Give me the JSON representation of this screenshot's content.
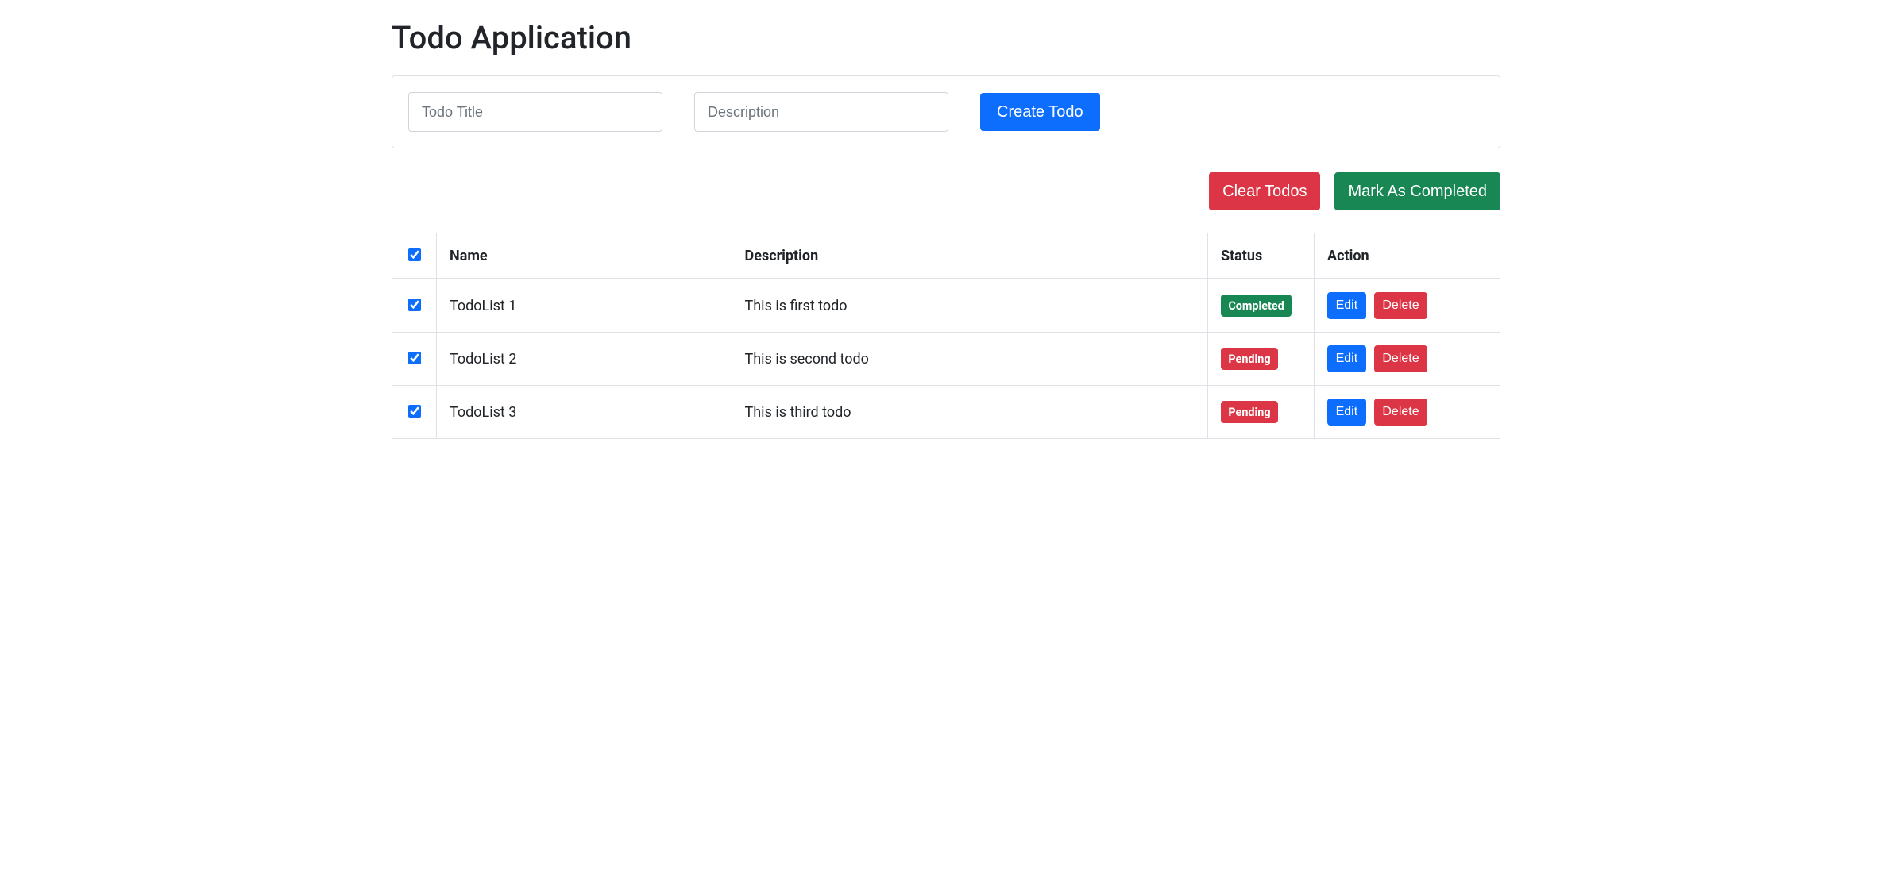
{
  "page": {
    "title": "Todo Application"
  },
  "form": {
    "title_placeholder": "Todo Title",
    "description_placeholder": "Description",
    "create_label": "Create Todo"
  },
  "bulk": {
    "clear_label": "Clear Todos",
    "mark_completed_label": "Mark As Completed"
  },
  "table": {
    "headers": {
      "name": "Name",
      "description": "Description",
      "status": "Status",
      "action": "Action"
    },
    "select_all_checked": true,
    "rows": [
      {
        "checked": true,
        "name": "TodoList 1",
        "description": "This is first todo",
        "status": "Completed",
        "status_kind": "success"
      },
      {
        "checked": true,
        "name": "TodoList 2",
        "description": "This is second todo",
        "status": "Pending",
        "status_kind": "danger"
      },
      {
        "checked": true,
        "name": "TodoList 3",
        "description": "This is third todo",
        "status": "Pending",
        "status_kind": "danger"
      }
    ]
  },
  "actions": {
    "edit_label": "Edit",
    "delete_label": "Delete"
  }
}
